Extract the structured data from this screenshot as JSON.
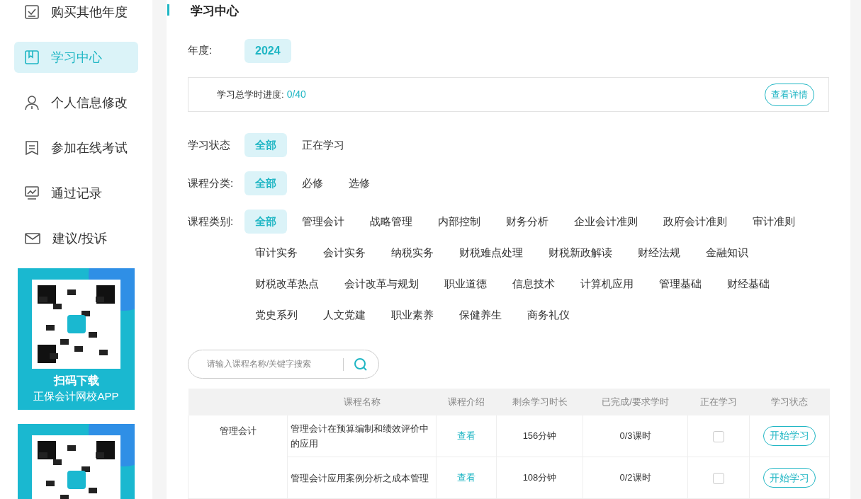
{
  "sidebar": {
    "items": [
      {
        "label": "购买其他年度",
        "kind": "check",
        "selected": false
      },
      {
        "label": "学习中心",
        "kind": "book",
        "selected": true
      },
      {
        "label": "个人信息修改",
        "kind": "user",
        "selected": false
      },
      {
        "label": "参加在线考试",
        "kind": "doc",
        "selected": false
      },
      {
        "label": "通过记录",
        "kind": "chart",
        "selected": false
      },
      {
        "label": "建议/投诉",
        "kind": "mail",
        "selected": false
      }
    ],
    "banners": [
      {
        "kind": "picture",
        "title": "扫码下载",
        "subtitle": "正保会计网校APP"
      },
      {
        "kind": "picture"
      }
    ]
  },
  "page": {
    "title": "学习中心",
    "year": {
      "label": "年度:",
      "options": [
        {
          "label": "2024",
          "selected": true
        }
      ]
    },
    "progress": {
      "label": "学习总学时进度:",
      "value": "0/40",
      "button": "查看详情"
    },
    "filters": [
      {
        "label": "学习状态",
        "options": [
          {
            "label": "全部",
            "selected": true
          },
          {
            "label": "正在学习",
            "selected": false
          }
        ]
      },
      {
        "label": "课程分类:",
        "options": [
          {
            "label": "全部",
            "selected": true
          },
          {
            "label": "必修",
            "selected": false
          },
          {
            "label": "选修",
            "selected": false
          }
        ]
      },
      {
        "label": "课程类别:",
        "options": [
          {
            "label": "全部",
            "selected": true
          },
          {
            "label": "管理会计",
            "selected": false
          },
          {
            "label": "战略管理",
            "selected": false
          },
          {
            "label": "内部控制",
            "selected": false
          },
          {
            "label": "财务分析",
            "selected": false
          },
          {
            "label": "企业会计准则",
            "selected": false
          },
          {
            "label": "政府会计准则",
            "selected": false
          },
          {
            "label": "审计准则",
            "selected": false
          },
          {
            "label": "审计实务",
            "selected": false
          },
          {
            "label": "会计实务",
            "selected": false
          },
          {
            "label": "纳税实务",
            "selected": false
          },
          {
            "label": "财税难点处理",
            "selected": false
          },
          {
            "label": "财税新政解读",
            "selected": false
          },
          {
            "label": "财经法规",
            "selected": false
          },
          {
            "label": "金融知识",
            "selected": false
          },
          {
            "label": "财税改革热点",
            "selected": false
          },
          {
            "label": "会计改革与规划",
            "selected": false
          },
          {
            "label": "职业道德",
            "selected": false
          },
          {
            "label": "信息技术",
            "selected": false
          },
          {
            "label": "计算机应用",
            "selected": false
          },
          {
            "label": "管理基础",
            "selected": false
          },
          {
            "label": "财经基础",
            "selected": false
          },
          {
            "label": "党史系列",
            "selected": false
          },
          {
            "label": "人文党建",
            "selected": false
          },
          {
            "label": "职业素养",
            "selected": false
          },
          {
            "label": "保健养生",
            "selected": false
          },
          {
            "label": "商务礼仪",
            "selected": false
          }
        ]
      }
    ],
    "search": {
      "placeholder": "请输入课程名称/关键字搜索"
    },
    "table": {
      "columns": [
        "课程名称",
        "课程介绍",
        "剩余学习时长",
        "已完成/要求学时",
        "正在学习",
        "学习状态"
      ],
      "groups": [
        {
          "category": "管理会计",
          "rows": [
            {
              "name": "管理会计在预算编制和绩效评价中的应用",
              "intro": "查看",
              "remaining": "156分钟",
              "completed": "0/3课时",
              "learning": false,
              "action": "开始学习"
            },
            {
              "name": "管理会计应用案例分析之成本管理",
              "intro": "查看",
              "remaining": "108分钟",
              "completed": "0/2课时",
              "learning": false,
              "action": "开始学习"
            }
          ]
        }
      ]
    }
  }
}
